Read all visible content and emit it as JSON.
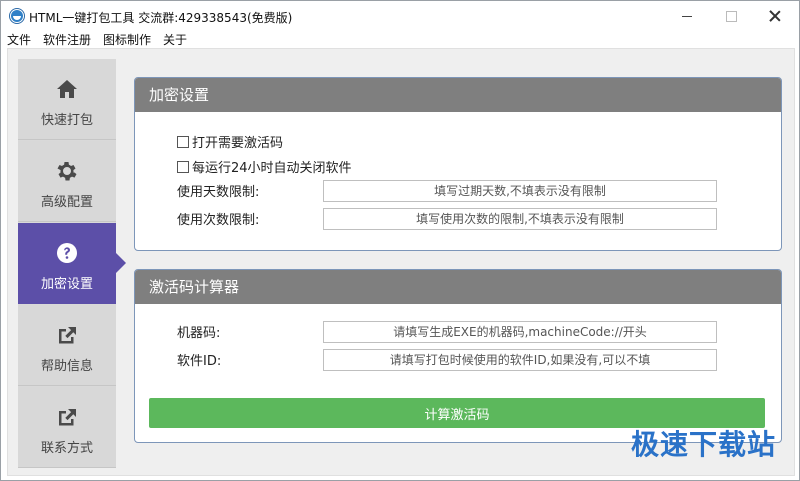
{
  "window": {
    "title": "HTML一键打包工具 交流群:429338543(免费版)"
  },
  "menu": {
    "items": [
      "文件",
      "软件注册",
      "图标制作",
      "关于"
    ]
  },
  "sidebar": {
    "items": [
      {
        "label": "快速打包",
        "icon": "home-icon"
      },
      {
        "label": "高级配置",
        "icon": "gear-icon"
      },
      {
        "label": "加密设置",
        "icon": "question-icon",
        "active": true
      },
      {
        "label": "帮助信息",
        "icon": "share-icon"
      },
      {
        "label": "联系方式",
        "icon": "share-icon"
      }
    ]
  },
  "encryption_panel": {
    "title": "加密设置",
    "checkbox_activation": "打开需要激活码",
    "checkbox_restart": "每运行24小时自动关闭软件",
    "days_label": "使用天数限制:",
    "days_placeholder": "填写过期天数,不填表示没有限制",
    "times_label": "使用次数限制:",
    "times_placeholder": "填写使用次数的限制,不填表示没有限制"
  },
  "calculator_panel": {
    "title": "激活码计算器",
    "machine_label": "机器码:",
    "machine_placeholder": "请填写生成EXE的机器码,machineCode://开头",
    "software_label": "软件ID:",
    "software_placeholder": "请填写打包时候使用的软件ID,如果没有,可以不填",
    "button_label": "计算激活码"
  },
  "watermark": "极速下载站",
  "colors": {
    "sidebar_active": "#5c4fa8",
    "panel_header": "#7f7f7f",
    "button_green": "#5cb85c"
  }
}
